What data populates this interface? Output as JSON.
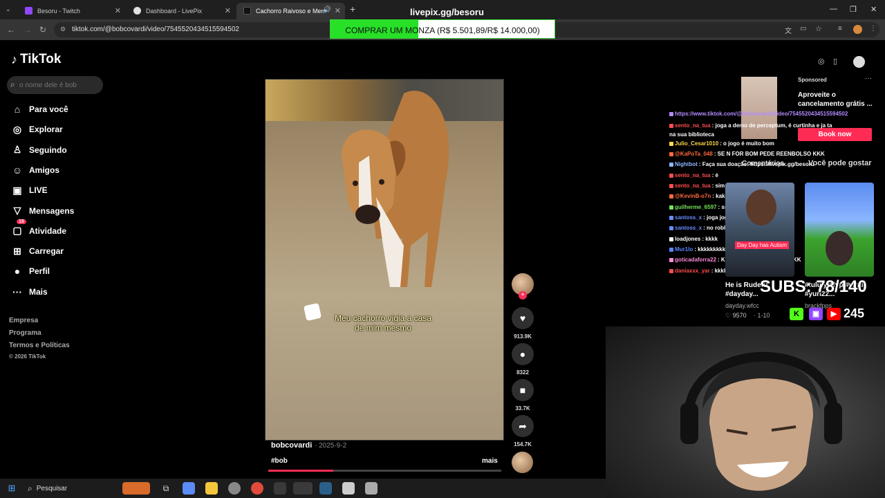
{
  "browser": {
    "tabs": [
      {
        "title": "Besoru - Twitch",
        "favicon_color": "#9146ff"
      },
      {
        "title": "Dashboard - LivePix",
        "favicon_color": "#e0e0e0"
      },
      {
        "title": "Cachorro Raivoso e Memes",
        "favicon_color": "#111111",
        "active": true
      }
    ],
    "new_tab_label": "+",
    "overlay_url": "livepix.gg/besoru",
    "address": "tiktok.com/@bobcovardi/video/7545520434515594502",
    "donation_goal": {
      "text": "COMPRAR UM MONZA (R$ 5.501,89/R$ 14.000,00)",
      "progress": 0.393
    }
  },
  "tiktok": {
    "logo": "TikTok",
    "search_placeholder": "o nome dele é bob",
    "nav": [
      {
        "label": "Para você",
        "icon": "home-icon",
        "glyph": "⌂"
      },
      {
        "label": "Explorar",
        "icon": "compass-icon",
        "glyph": "◎"
      },
      {
        "label": "Seguindo",
        "icon": "user-follow-icon",
        "glyph": "♙"
      },
      {
        "label": "Amigos",
        "icon": "friends-icon",
        "glyph": "☺"
      },
      {
        "label": "LIVE",
        "icon": "live-icon",
        "glyph": "▣"
      },
      {
        "label": "Mensagens",
        "icon": "send-icon",
        "glyph": "▽"
      },
      {
        "label": "Atividade",
        "icon": "activity-icon",
        "glyph": "▢",
        "badge": "15"
      },
      {
        "label": "Carregar",
        "icon": "upload-icon",
        "glyph": "⊞"
      },
      {
        "label": "Perfil",
        "icon": "profile-avatar-icon",
        "glyph": "●"
      },
      {
        "label": "Mais",
        "icon": "more-icon",
        "glyph": "···"
      }
    ],
    "footer": [
      "Empresa",
      "Programa",
      "Termos e Políticas",
      "© 2026 TikTok"
    ],
    "video": {
      "caption_line1": "Meu cachorro vigia a casa",
      "caption_line2": "de mim mesmo",
      "author": "bobcovardi",
      "date": "· 2025-9-2",
      "hashtag": "#bob",
      "more": "mais",
      "progress": 0.28
    },
    "actions": [
      {
        "name": "like",
        "icon": "heart-icon",
        "glyph": "♥",
        "count": "913.9K"
      },
      {
        "name": "comment",
        "icon": "comment-icon",
        "glyph": "●",
        "count": "8322"
      },
      {
        "name": "bookmark",
        "icon": "bookmark-icon",
        "glyph": "■",
        "count": "33.7K"
      },
      {
        "name": "share",
        "icon": "share-icon",
        "glyph": "➦",
        "count": "154.7K"
      }
    ]
  },
  "right": {
    "sponsored": "Sponsored",
    "ad_title": "Aproveite o cancelamento grátis ...",
    "ad_button": "Book now",
    "comentarios": "Comentários",
    "voce_pode_gostar": "Você pode gostar",
    "chat": [
      {
        "user": "https://www.tiktok.com/@bobcovardi/video/7545520434515594502",
        "msg": "",
        "color": "#b28cff"
      },
      {
        "user": "sento_na_tua",
        "msg": ": joga a demo de perceptum, é curtinha e ja ta na sua biblioteca",
        "color": "#ff4d4d"
      },
      {
        "user": "Julio_Cesar1010",
        "msg": ": o jogo é muito bom",
        "color": "#ffd84d"
      },
      {
        "user": "@KaPoTa_048",
        "msg": ": SE N FOR BOM PEDE REENBOLSO KKK",
        "color": "#ff6a3d"
      },
      {
        "user": "Nightbot",
        "msg": ": Faça sua doação: https://livepix.gg/besoru",
        "color": "#8fb6ff"
      },
      {
        "user": "sento_na_tua",
        "msg": ": é",
        "color": "#ff4d4d"
      },
      {
        "user": "sento_na_tua",
        "msg": ": sim",
        "color": "#ff4d4d"
      },
      {
        "user": "@KevinB-o7n",
        "msg": ": kaka",
        "color": "#ff6a3d"
      },
      {
        "user": "guilherme_6597",
        "msg": ": ss",
        "color": "#74e25a"
      },
      {
        "user": "santoss_x",
        "msg": ": joga jogo de teror",
        "color": "#6a8cff"
      },
      {
        "user": "santoss_x",
        "msg": ": no roblox",
        "color": "#6a8cff"
      },
      {
        "user": "loadjones",
        "msg": ": kkkk",
        "color": "#ffffff"
      },
      {
        "user": "Mur1lo",
        "msg": ": kkkkkkkkkkkkkkkkkk",
        "color": "#5a86ff"
      },
      {
        "user": "goticadaforra22",
        "msg": ": KKKKKKKKKKKKKKKKKKKK",
        "color": "#ff8ad8"
      },
      {
        "user": "daniaxxx_yar",
        "msg": ": kkkkkkkkkkkk",
        "color": "#ff4d4d"
      }
    ],
    "card1": {
      "overlay": "Day Day has Autism",
      "title": "He is Rude!!! #dayday...",
      "author": "dayday.wfcc",
      "likes": "♡ 9570",
      "date": "· 1-10"
    },
    "card2": {
      "title": "#tululy #fyp #viral #yuri22...",
      "author": "brackfpps"
    },
    "subs": "SUBS: 78/140",
    "viewers": "245"
  },
  "taskbar": {
    "search": "Pesquisar"
  }
}
